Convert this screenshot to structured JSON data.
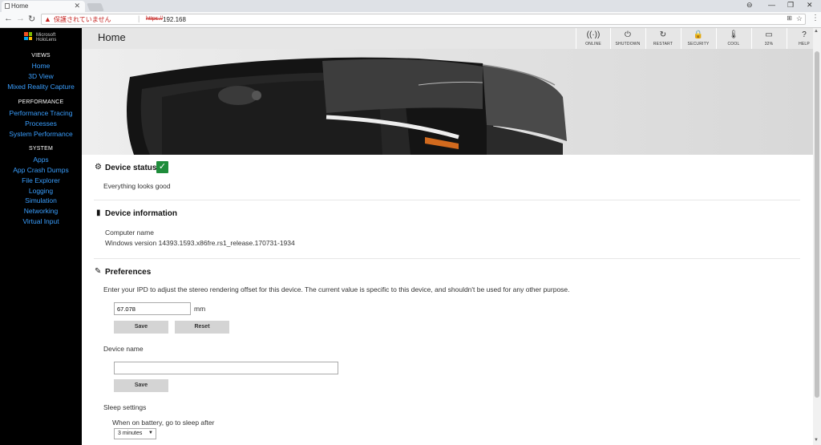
{
  "browser": {
    "tab_title": "Home",
    "tab_close": "✕",
    "security_text": "保護されていません",
    "url_scheme": "https://",
    "url_host": "192.168",
    "window_controls": [
      "⊖",
      "—",
      "❐",
      "✕"
    ]
  },
  "sidebar": {
    "logo_line1": "Microsoft",
    "logo_line2": "HoloLens",
    "logo_colors": [
      "#f25022",
      "#7fba00",
      "#00a4ef",
      "#ffb900"
    ],
    "sections": [
      {
        "heading": "VIEWS",
        "items": [
          "Home",
          "3D View",
          "Mixed Reality Capture"
        ]
      },
      {
        "heading": "PERFORMANCE",
        "items": [
          "Performance Tracing",
          "Processes",
          "System Performance"
        ]
      },
      {
        "heading": "SYSTEM",
        "items": [
          "Apps",
          "App Crash Dumps",
          "File Explorer",
          "Logging",
          "Simulation",
          "Networking",
          "Virtual Input"
        ]
      }
    ]
  },
  "header": {
    "title": "Home",
    "buttons": [
      {
        "label": "ONLINE",
        "icon": "wireless-icon",
        "glyph": "((·))"
      },
      {
        "label": "SHUTDOWN",
        "icon": "power-icon",
        "glyph": "⏻"
      },
      {
        "label": "RESTART",
        "icon": "restart-icon",
        "glyph": "↻"
      },
      {
        "label": "SECURITY",
        "icon": "lock-icon",
        "glyph": "🔒"
      },
      {
        "label": "COOL",
        "icon": "thermometer-icon",
        "glyph": "🌡"
      },
      {
        "label": "32%",
        "icon": "battery-icon",
        "glyph": "▭"
      },
      {
        "label": "HELP",
        "icon": "help-icon",
        "glyph": "?"
      }
    ]
  },
  "device_status": {
    "title": "Device status",
    "message": "Everything looks good"
  },
  "device_info": {
    "title": "Device information",
    "computer_name_label": "Computer name",
    "windows_version": "Windows version 14393.1593.x86fre.rs1_release.170731-1934"
  },
  "preferences": {
    "title": "Preferences",
    "ipd_description": "Enter your IPD to adjust the stereo rendering offset for this device. The current value is specific to this device, and shouldn't be used for any other purpose.",
    "ipd_value": "67.078",
    "ipd_unit": "mm",
    "save_label": "Save",
    "reset_label": "Reset",
    "device_name_label": "Device name",
    "device_name_value": "",
    "device_name_save": "Save",
    "sleep_settings_label": "Sleep settings",
    "battery_sleep_label": "When on battery, go to sleep after",
    "battery_sleep_value": "3 minutes"
  }
}
